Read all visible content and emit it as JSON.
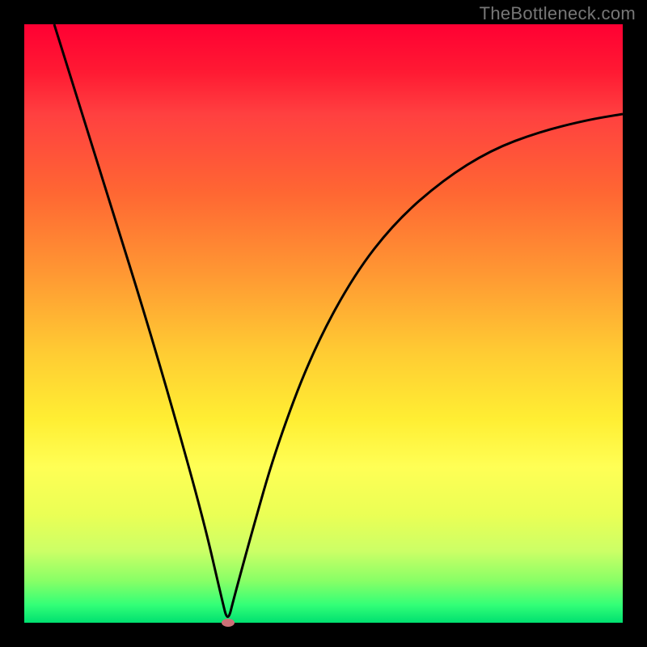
{
  "watermark": "TheBottleneck.com",
  "chart_data": {
    "type": "line",
    "title": "",
    "xlabel": "",
    "ylabel": "",
    "xlim": [
      0,
      100
    ],
    "ylim": [
      0,
      100
    ],
    "grid": false,
    "legend": false,
    "series": [
      {
        "name": "curve",
        "x": [
          5,
          10,
          15,
          20,
          25,
          30,
          33,
          34,
          35,
          38,
          42,
          48,
          55,
          62,
          70,
          78,
          86,
          94,
          100
        ],
        "y": [
          100,
          84,
          68,
          52,
          35,
          17,
          4,
          0,
          4,
          15,
          29,
          45,
          58,
          67,
          74,
          79,
          82,
          84,
          85
        ]
      }
    ],
    "minimum_point": {
      "x": 34,
      "y": 0
    },
    "colors": {
      "curve": "#000000",
      "dot": "#cc6f77",
      "gradient_top": "#ff0033",
      "gradient_bottom": "#00e070",
      "frame": "#000000"
    }
  }
}
